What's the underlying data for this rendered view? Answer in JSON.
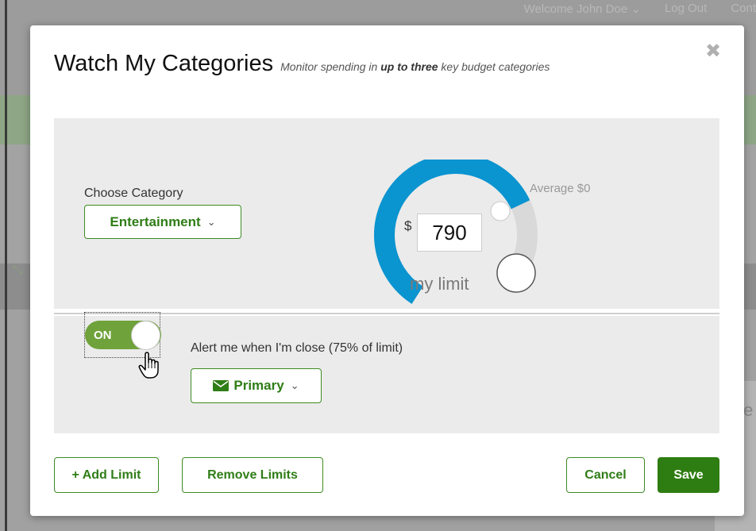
{
  "background": {
    "header_links": [
      "Welcome John Doe ⌄",
      "Log Out",
      "Cont"
    ],
    "partial_text": "te"
  },
  "modal": {
    "title": "Watch My Categories",
    "subtitle_pre": "Monitor spending in ",
    "subtitle_bold": "up to three",
    "subtitle_post": " key budget categories",
    "close_icon": "✖"
  },
  "category": {
    "label": "Choose Category",
    "selected": "Entertainment"
  },
  "gauge": {
    "currency_symbol": "$",
    "limit_value": "790",
    "limit_caption": "my limit",
    "average_label": "Average $0",
    "fill_fraction": 0.72,
    "arc_color": "#0a94d0"
  },
  "alert": {
    "toggle_label": "ON",
    "toggle_on": true,
    "text": "Alert me when I'm close (75% of limit)",
    "channel": "Primary",
    "channel_icon": "envelope-icon"
  },
  "footer": {
    "add_limit": "+ Add Limit",
    "remove_limits": "Remove Limits",
    "cancel": "Cancel",
    "save": "Save"
  },
  "colors": {
    "accent_green": "#2e7d12",
    "toggle_green": "#6fa23a",
    "gauge_blue": "#0a94d0"
  }
}
